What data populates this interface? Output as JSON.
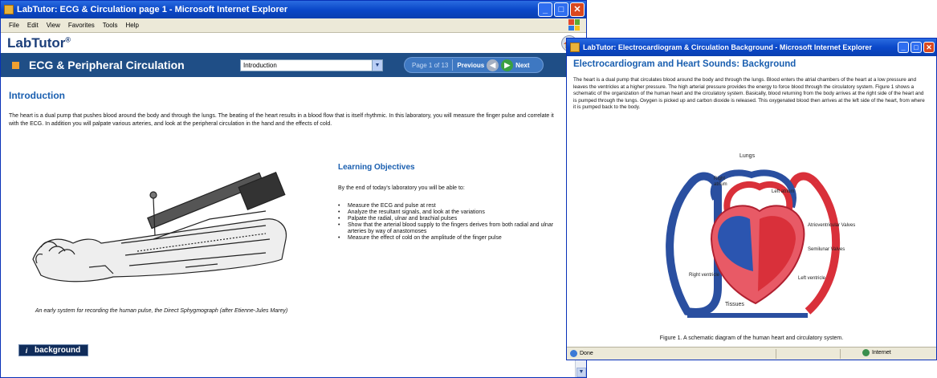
{
  "window1": {
    "title": "LabTutor: ECG & Circulation page 1 - Microsoft Internet Explorer",
    "menu": [
      "File",
      "Edit",
      "View",
      "Favorites",
      "Tools",
      "Help"
    ],
    "logo": "LabTutor",
    "logo_mark": "®",
    "nav": {
      "title": "ECG & Peripheral Circulation",
      "page_select": "Introduction",
      "page_indicator": "Page 1 of 13",
      "previous": "Previous",
      "next": "Next"
    },
    "section_title": "Introduction",
    "intro_text": "The heart is a dual pump that pushes blood around the body and through the lungs. The beating of the heart results in a blood flow that is itself rhythmic. In this laboratory, you will measure the finger pulse and correlate it with the ECG. In addition you will palpate various arteries, and look at the peripheral circulation in the hand and the effects of cold.",
    "image_caption": "An early system for recording the human pulse, the Direct Sphygmograph (after Etienne-Jules Marey)",
    "objectives": {
      "heading": "Learning Objectives",
      "intro": "By the end of today's laboratory you will be able to:",
      "items": [
        "Measure the ECG and pulse at rest",
        "Analyze the resultant signals, and look at the variations",
        "Palpate the radial, ulnar and brachial pulses",
        "Show that the arterial blood supply to the fingers derives from both radial and ulnar arteries by way of anastomoses",
        "Measure the effect of cold on the amplitude of the finger pulse"
      ]
    },
    "background_button": "background"
  },
  "window2": {
    "title": "LabTutor: Electrocardiogram & Circulation Background - Microsoft Internet Explorer",
    "heading": "Electrocardiogram and Heart Sounds: Background",
    "body": "The heart is a dual pump that circulates blood around the body and through the lungs. Blood enters the atrial chambers of the heart at a low pressure and leaves the ventricles at a higher pressure. The high arterial pressure provides the energy to force blood through the circulatory system. Figure 1 shows a schematic of the organization of the human heart and the circulatory system. Basically, blood returning from the body arrives at the right side of the heart and is pumped through the lungs. Oxygen is picked up and carbon dioxide is released. This oxygenated blood then arrives at the left side of the heart, from where it is pumped back to the body.",
    "diagram_labels": {
      "lungs": "Lungs",
      "right_atrium": "Right atrium",
      "left_atrium": "Left atrium",
      "av_valves": "Atrioventricular Valves",
      "semilunar_valves": "Semilunar Valves",
      "right_ventricle": "Right ventricle",
      "left_ventricle": "Left ventricle",
      "tissues": "Tissues"
    },
    "figure_caption": "Figure 1. A schematic diagram of the human heart and circulatory system.",
    "status_text": "Done",
    "zone": "Internet"
  },
  "colors": {
    "xp_title": "#0b48c9",
    "labtutor_nav": "#1f4e86",
    "heading_blue": "#1a5fb0",
    "accent_orange": "#f0a030",
    "artery_red": "#d9303a",
    "vein_blue": "#2a4fa0"
  }
}
